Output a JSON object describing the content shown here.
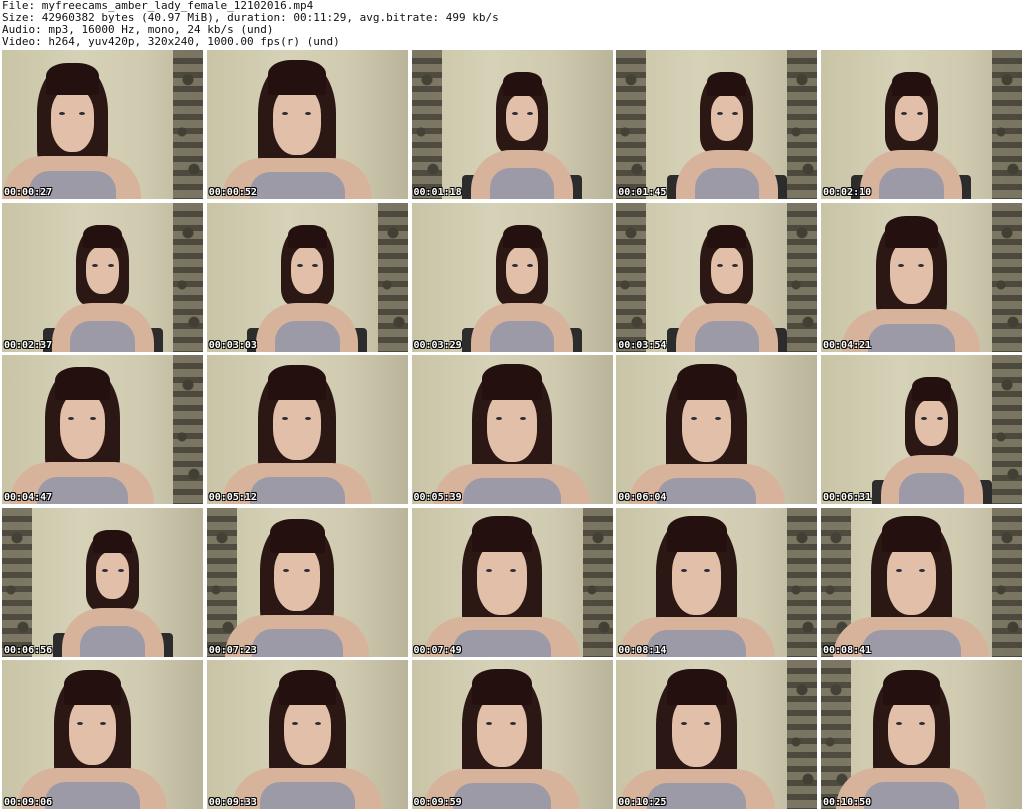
{
  "header": {
    "file_line": "File: myfreecams_amber_lady_female_12102016.mp4",
    "size_line": "Size: 42960382 bytes (40.97 MiB), duration: 00:11:29, avg.bitrate: 499 kb/s",
    "audio_line": "Audio: mp3, 16000 Hz, mono, 24 kb/s (und)",
    "video_line": "Video: h264, yuv420p, 320x240, 1000.00 fps(r) (und)"
  },
  "thumbnails": [
    {
      "timestamp": "00:00:27"
    },
    {
      "timestamp": "00:00:52"
    },
    {
      "timestamp": "00:01:18"
    },
    {
      "timestamp": "00:01:45"
    },
    {
      "timestamp": "00:02:10"
    },
    {
      "timestamp": "00:02:37"
    },
    {
      "timestamp": "00:03:03"
    },
    {
      "timestamp": "00:03:29"
    },
    {
      "timestamp": "00:03:54"
    },
    {
      "timestamp": "00:04:21"
    },
    {
      "timestamp": "00:04:47"
    },
    {
      "timestamp": "00:05:12"
    },
    {
      "timestamp": "00:05:39"
    },
    {
      "timestamp": "00:06:04"
    },
    {
      "timestamp": "00:06:31"
    },
    {
      "timestamp": "00:06:56"
    },
    {
      "timestamp": "00:07:23"
    },
    {
      "timestamp": "00:07:49"
    },
    {
      "timestamp": "00:08:14"
    },
    {
      "timestamp": "00:08:41"
    },
    {
      "timestamp": "00:09:06"
    },
    {
      "timestamp": "00:09:33"
    },
    {
      "timestamp": "00:09:59"
    },
    {
      "timestamp": "00:10:25"
    },
    {
      "timestamp": "00:10:50"
    }
  ]
}
